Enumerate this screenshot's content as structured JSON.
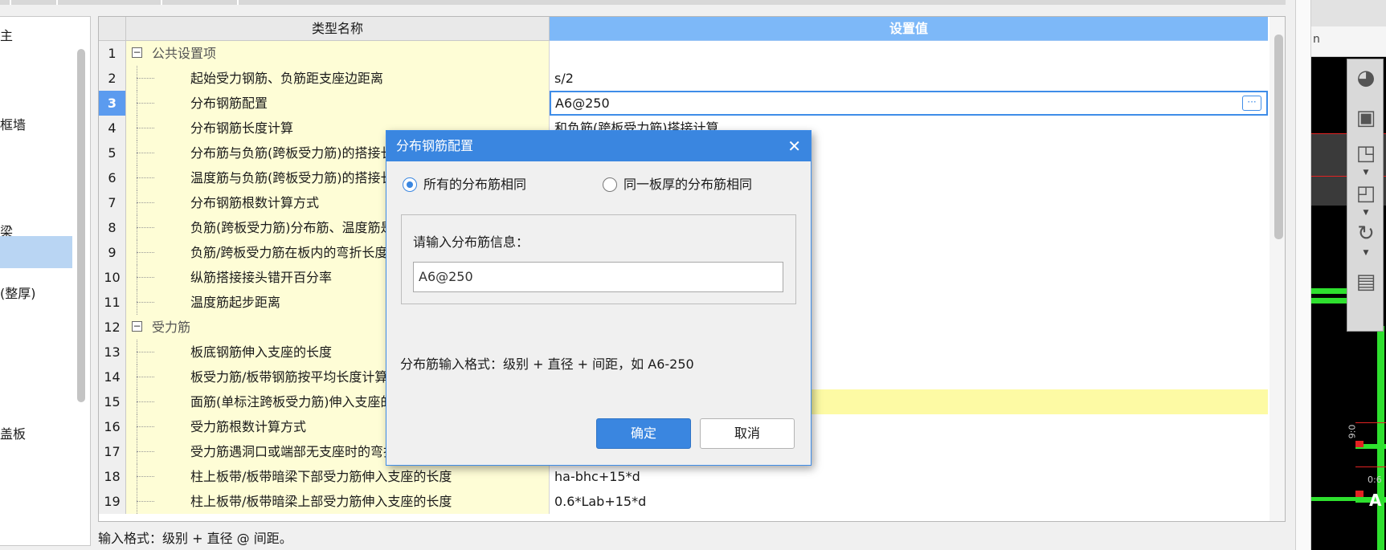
{
  "left_panel": {
    "items": [
      {
        "label": "主"
      },
      {
        "label": "框墙"
      },
      {
        "label": "梁"
      },
      {
        "label": ""
      },
      {
        "label": "(整厚)"
      },
      {
        "label": "盖板"
      }
    ]
  },
  "grid": {
    "header_name": "类型名称",
    "header_value": "设置值",
    "rows": [
      {
        "num": "1",
        "name": "公共设置项",
        "value": ""
      },
      {
        "num": "2",
        "name": "起始受力钢筋、负筋距支座边距离",
        "value": "s/2"
      },
      {
        "num": "3",
        "name": "分布钢筋配置",
        "value": "A6@250"
      },
      {
        "num": "4",
        "name": "分布钢筋长度计算",
        "value": "和负筋(跨板受力筋)搭接计算"
      },
      {
        "num": "5",
        "name": "分布筋与负筋(跨板受力筋)的搭接长度",
        "value": ""
      },
      {
        "num": "6",
        "name": "温度筋与负筋(跨板受力筋)的搭接长度",
        "value": ""
      },
      {
        "num": "7",
        "name": "分布钢筋根数计算方式",
        "value": ""
      },
      {
        "num": "8",
        "name": "负筋(跨板受力筋)分布筋、温度筋是否带弯勾",
        "value": ""
      },
      {
        "num": "9",
        "name": "负筋/跨板受力筋在板内的弯折长度",
        "value": ""
      },
      {
        "num": "10",
        "name": "纵筋搭接接头错开百分率",
        "value": ""
      },
      {
        "num": "11",
        "name": "温度筋起步距离",
        "value": ""
      },
      {
        "num": "12",
        "name": "受力筋",
        "value": ""
      },
      {
        "num": "13",
        "name": "板底钢筋伸入支座的长度",
        "value": ""
      },
      {
        "num": "14",
        "name": "板受力筋/板带钢筋按平均长度计算",
        "value": ""
      },
      {
        "num": "15",
        "name": "面筋(单标注跨板受力筋)伸入支座的锚固长度",
        "value": ""
      },
      {
        "num": "16",
        "name": "受力筋根数计算方式",
        "value": ""
      },
      {
        "num": "17",
        "name": "受力筋遇洞口或端部无支座时的弯折长度",
        "value": ""
      },
      {
        "num": "18",
        "name": "柱上板带/板带暗梁下部受力筋伸入支座的长度",
        "value": "ha-bhc+15*d"
      },
      {
        "num": "19",
        "name": "柱上板带/板带暗梁上部受力筋伸入支座的长度",
        "value": "0.6*Lab+15*d"
      }
    ]
  },
  "hint": "输入格式：级别 + 直径 @ 间距。",
  "cad": {
    "tab_text": "n",
    "labels": [
      "9:0",
      "0:6"
    ],
    "marker": "A"
  },
  "dialog": {
    "title": "分布钢筋配置",
    "radio_all": "所有的分布筋相同",
    "radio_same_thickness": "同一板厚的分布筋相同",
    "group_label": "请输入分布筋信息：",
    "input_value": "A6@250",
    "format_text": "分布筋输入格式：级别 + 直径 + 间距，如 A6-250",
    "ok_label": "确定",
    "cancel_label": "取消"
  }
}
